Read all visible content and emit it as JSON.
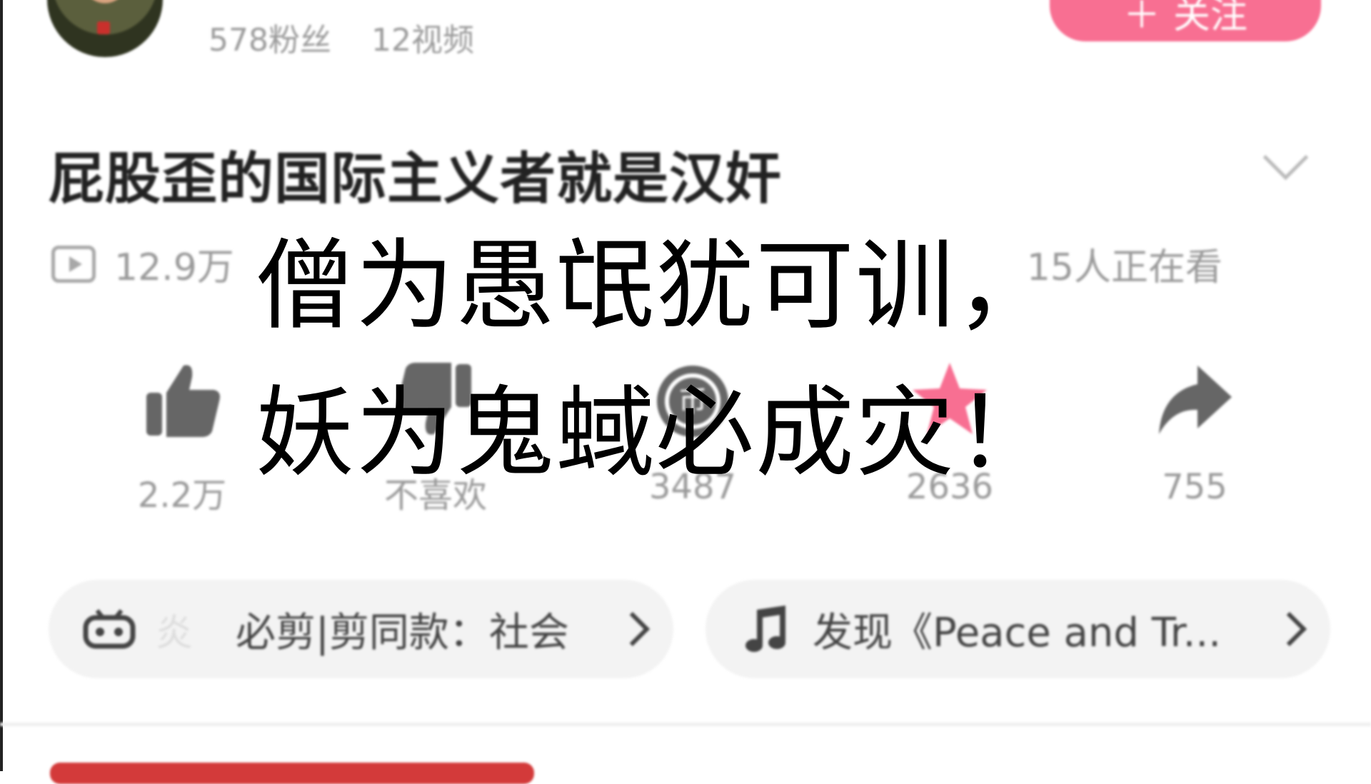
{
  "channel": {
    "fans": "578粉丝",
    "videos": "12视频",
    "follow_label": "关注"
  },
  "video": {
    "title": "屁股歪的国际主义者就是汉奸",
    "views": "12.9万",
    "watching": "15人正在看"
  },
  "actions": [
    {
      "name": "like",
      "count": "2.2万"
    },
    {
      "name": "dislike",
      "count": "不喜欢"
    },
    {
      "name": "coin",
      "count": "3487"
    },
    {
      "name": "favorite",
      "count": "2636"
    },
    {
      "name": "share",
      "count": "755"
    }
  ],
  "tags": {
    "tag1_text": "必剪|剪同款：社会",
    "tag2_text": "发现《Peace and Tr..."
  },
  "overlay": {
    "line1": "僧为愚氓犹可训，",
    "line2": "妖为鬼蜮必成灾！"
  },
  "colors": {
    "accent": "#f86f92",
    "muted": "#9a9a9a"
  }
}
